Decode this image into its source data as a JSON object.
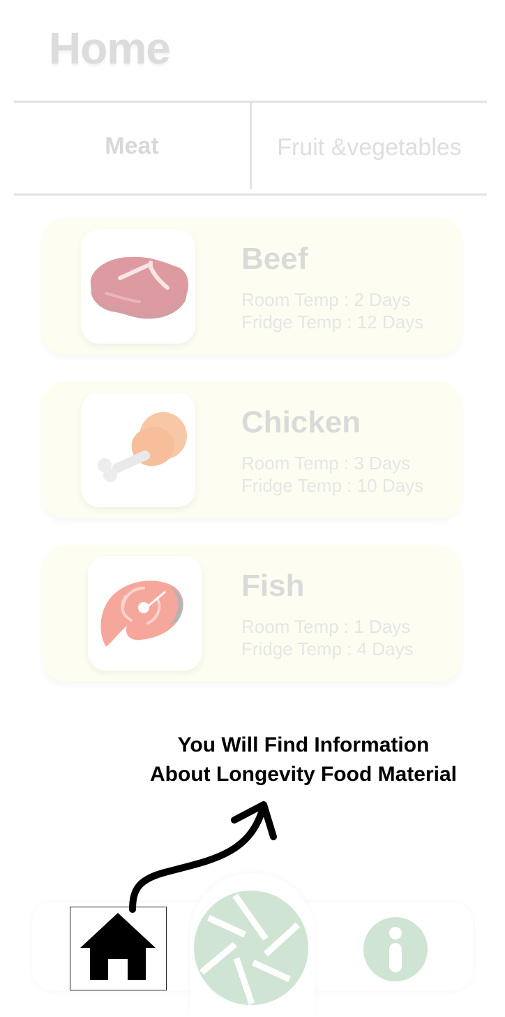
{
  "header": {
    "title": "Home"
  },
  "tabs": [
    {
      "label": "Meat"
    },
    {
      "label_line1": "Fruit &",
      "label_line2": "vegetables"
    }
  ],
  "foods": [
    {
      "name": "Beef",
      "room": "Room Temp : 2 Days",
      "fridge": "Fridge Temp : 12 Days",
      "icon": "steak-icon"
    },
    {
      "name": "Chicken",
      "room": "Room Temp : 3 Days",
      "fridge": "Fridge Temp : 10 Days",
      "icon": "drumstick-icon"
    },
    {
      "name": "Fish",
      "room": "Room Temp : 1 Days",
      "fridge": "Fridge Temp : 4 Days",
      "icon": "salmon-steak-icon"
    }
  ],
  "tutorial": {
    "line1": "You Will Find Information",
    "line2": "About Longevity Food Material"
  },
  "nav": {
    "home_icon": "home-icon",
    "camera_icon": "camera-shutter-icon",
    "info_icon": "info-icon",
    "accent_color": "#cfe4d3"
  }
}
